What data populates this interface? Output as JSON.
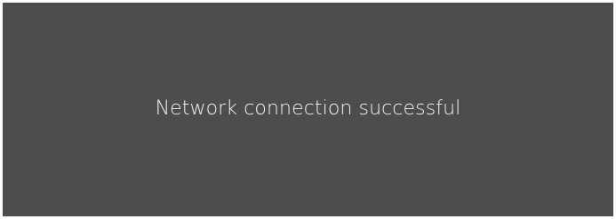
{
  "notification": {
    "message": "Network connection successful",
    "background_color": "#4d4d4d",
    "text_color": "#f2f2f2"
  }
}
